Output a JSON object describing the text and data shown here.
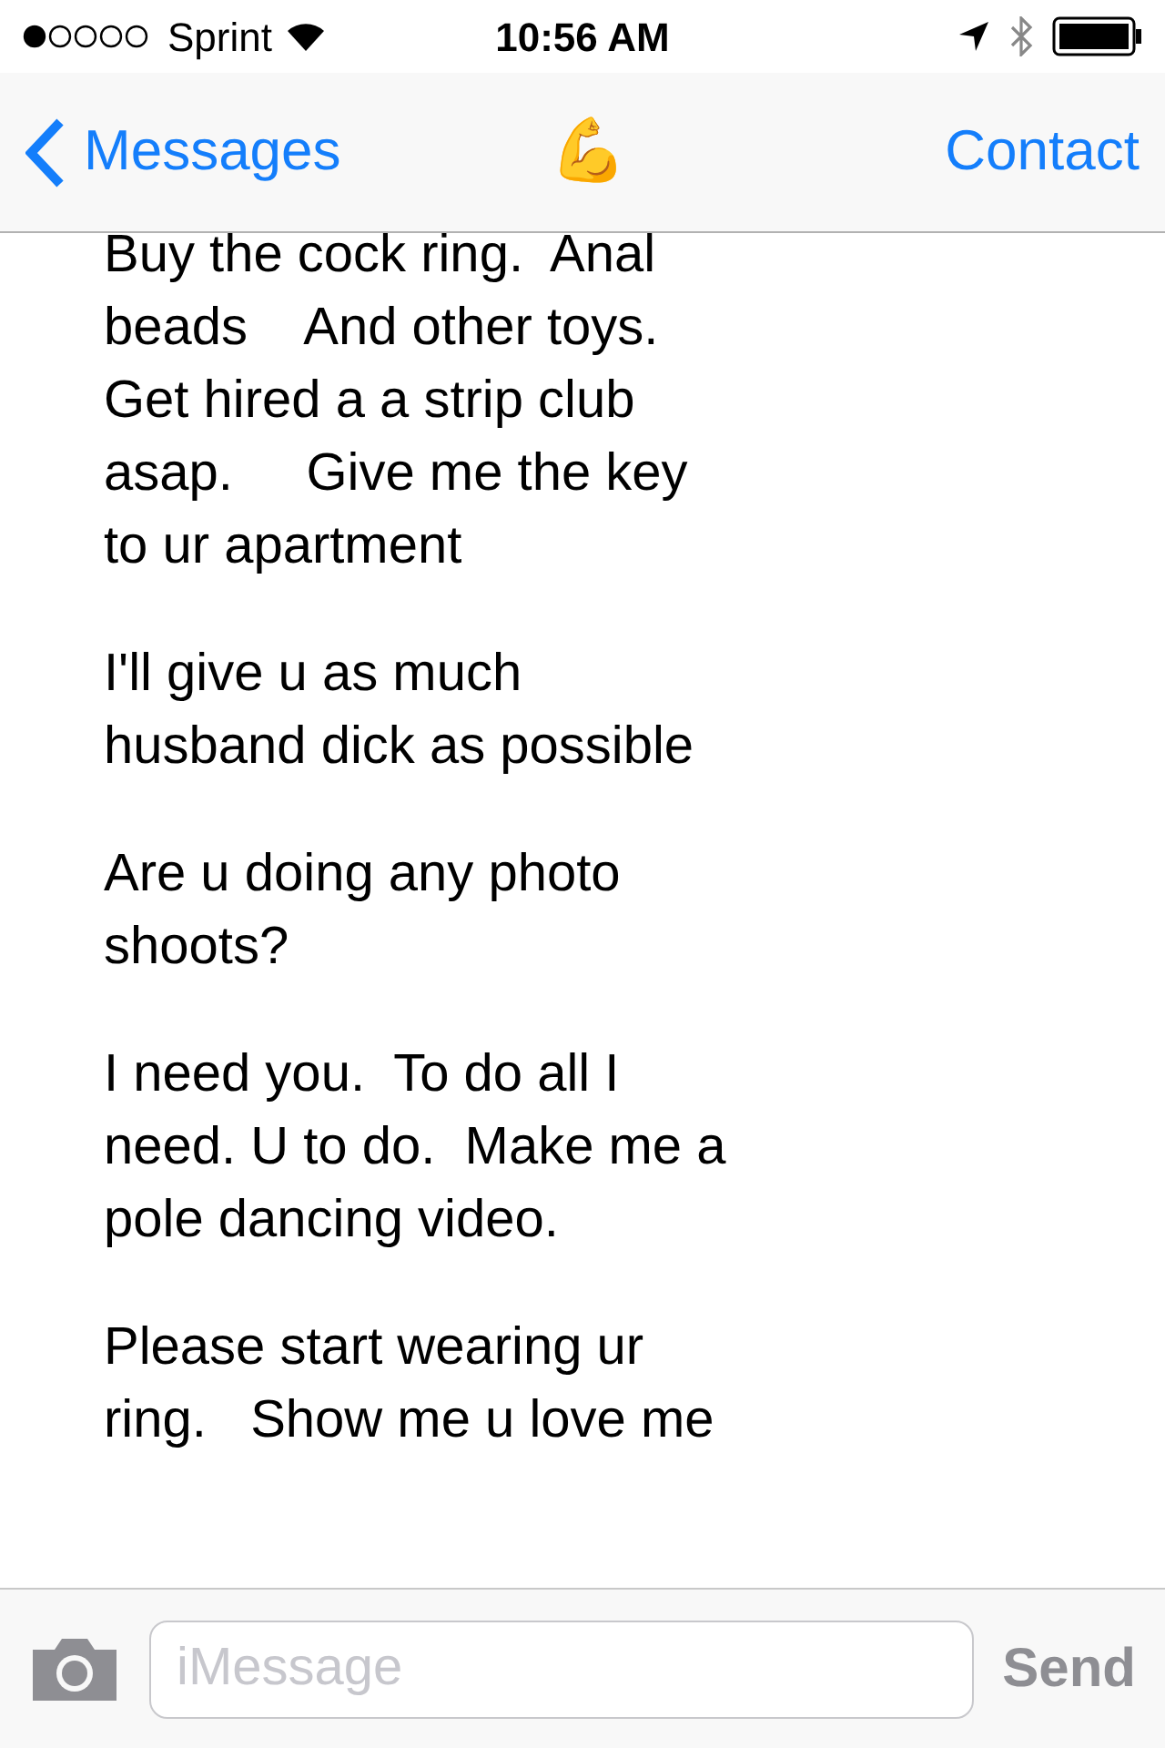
{
  "status_bar": {
    "carrier": "Sprint",
    "time": "10:56 AM"
  },
  "nav": {
    "back": "Messages",
    "title": "💪",
    "action": "Contact"
  },
  "messages": [
    {
      "lines": [
        "Buy the cock ring.  Anal",
        "beads    And other toys.",
        "Get hired a a strip club",
        "asap.     Give me the key",
        "to ur apartment"
      ]
    },
    {
      "lines": [
        "I'll give u as much",
        "husband dick as possible"
      ]
    },
    {
      "lines": [
        "Are u doing any photo",
        "shoots?"
      ]
    },
    {
      "lines": [
        "I need you.  To do all I",
        "need. U to do.  Make me a",
        "pole dancing video."
      ]
    },
    {
      "lines": [
        "Please start wearing ur",
        "ring.   Show me u love me"
      ]
    }
  ],
  "composer": {
    "placeholder": "iMessage",
    "send": "Send"
  }
}
